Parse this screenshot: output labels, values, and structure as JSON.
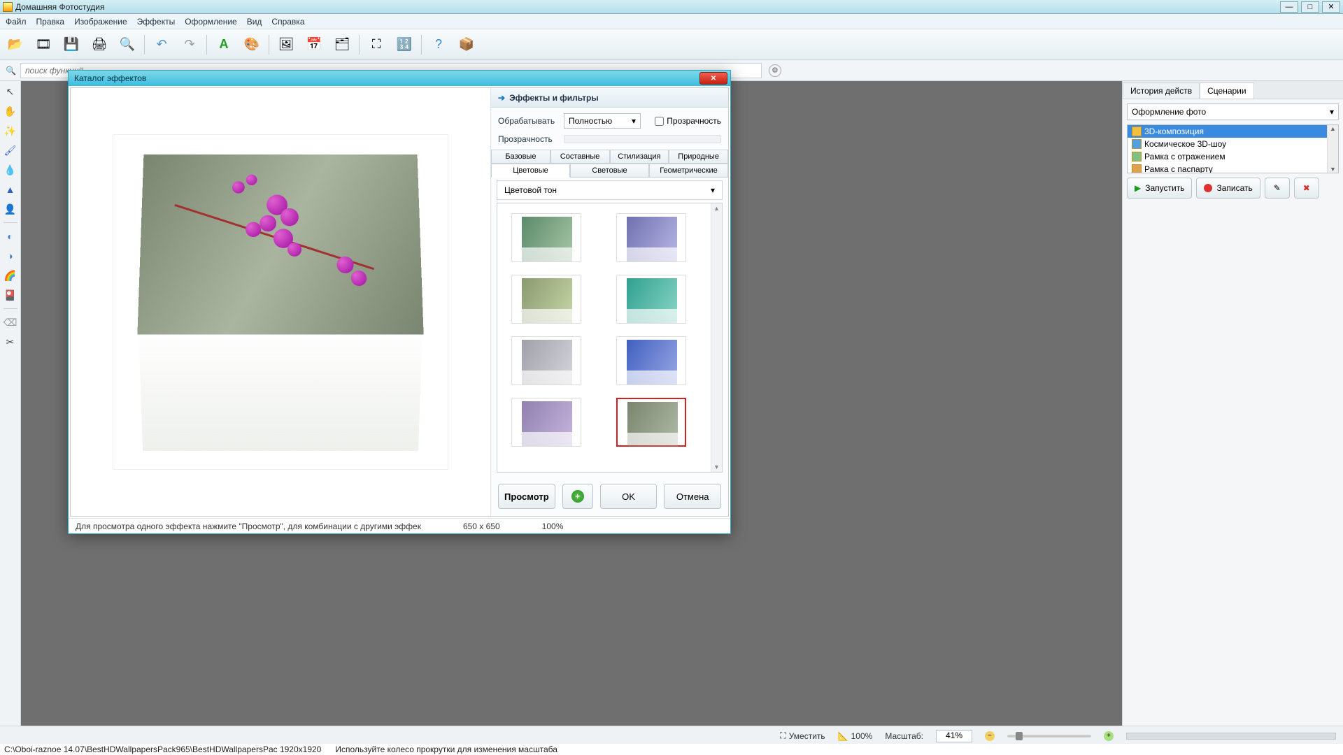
{
  "app": {
    "title": "Домашняя Фотостудия"
  },
  "menu": {
    "file": "Файл",
    "edit": "Правка",
    "image": "Изображение",
    "effects": "Эффекты",
    "design": "Оформление",
    "view": "Вид",
    "help": "Справка"
  },
  "search": {
    "placeholder": "поиск функций..."
  },
  "right_panel": {
    "tabs": {
      "history": "История действ",
      "scripts": "Сценарии"
    },
    "category": "Оформление фото",
    "items": [
      "3D-композиция",
      "Космическое 3D-шоу",
      "Рамка с отражением",
      "Рамка с паспарту"
    ],
    "buttons": {
      "run": "Запустить",
      "record": "Записать"
    }
  },
  "status": {
    "fit": "Уместить",
    "hundred": "100%",
    "scale_label": "Масштаб:",
    "scale_value": "41%"
  },
  "pathbar": {
    "path": "C:\\Oboi-raznoe 14.07\\BestHDWallpapersPack965\\BestHDWallpapersPac 1920x1920",
    "hint": "Используйте колесо прокрутки для изменения масштаба"
  },
  "dialog": {
    "title": "Каталог эффектов",
    "section": "Эффекты и фильтры",
    "process_label": "Обрабатывать",
    "process_value": "Полностью",
    "transparency_chk": "Прозрачность",
    "transparency_label": "Прозрачность",
    "tabs_row1": [
      "Базовые",
      "Составные",
      "Стилизация",
      "Природные"
    ],
    "tabs_row2": [
      "Цветовые",
      "Световые",
      "Геометрические"
    ],
    "tabs_row2_selected": 0,
    "category": "Цветовой тон",
    "thumbs": [
      {
        "bg": "linear-gradient(120deg,#5a8a6a,#a0c0a0)"
      },
      {
        "bg": "linear-gradient(120deg,#7070b0,#b0b0e0)"
      },
      {
        "bg": "linear-gradient(120deg,#8a9a70,#c0d0a0)"
      },
      {
        "bg": "linear-gradient(120deg,#30a090,#80d0c0)"
      },
      {
        "bg": "linear-gradient(120deg,#a0a0a8,#d0d0d8)"
      },
      {
        "bg": "linear-gradient(120deg,#4060c0,#90a0e0)"
      },
      {
        "bg": "linear-gradient(120deg,#9080b0,#c0b0d8)"
      },
      {
        "bg": "linear-gradient(120deg,#7a8570,#aab5a0)"
      }
    ],
    "thumb_selected": 7,
    "buttons": {
      "preview": "Просмотр",
      "ok": "OK",
      "cancel": "Отмена"
    },
    "status_hint": "Для просмотра одного эффекта нажмите \"Просмотр\", для комбинации с другими эффек",
    "status_dim": "650 x 650",
    "status_zoom": "100%"
  }
}
